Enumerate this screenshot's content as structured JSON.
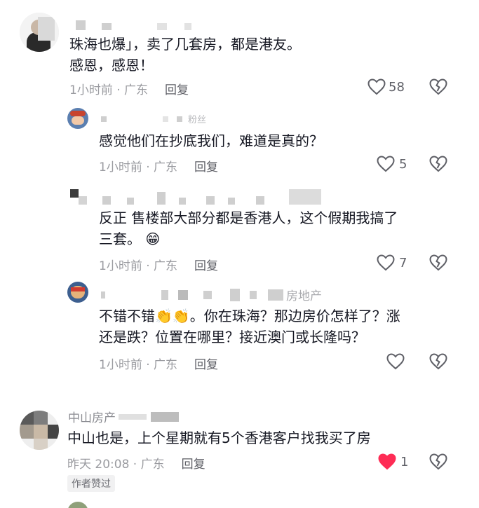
{
  "comments": [
    {
      "id": "c1",
      "username": "",
      "text_lines": [
        "珠海也爆」，卖了几套房，都是港友。",
        "感恩，感恩！"
      ],
      "meta": "1小时前 · 广东",
      "reply_label": "回复",
      "likes": "58",
      "liked": false
    },
    {
      "id": "c2",
      "username_suffix": "粉丝",
      "text_lines": [
        "感觉他们在抄底我们，难道是真的？"
      ],
      "meta": "1小时前 · 广东",
      "reply_label": "回复",
      "likes": "5",
      "liked": false
    },
    {
      "id": "c3",
      "text_lines": [
        "反正 售楼部大部分都是香港人，这个假期我搞了",
        "三套。"
      ],
      "emoji": "😁",
      "meta": "1小时前 · 广东",
      "reply_label": "回复",
      "likes": "7",
      "liked": false
    },
    {
      "id": "c4",
      "username_suffix": "房地产",
      "text_lines": [
        "不错不错👏👏。你在珠海？那边房价怎样了？涨",
        "还是跌？位置在哪里？接近澳门或长隆吗？"
      ],
      "meta": "1小时前 · 广东",
      "reply_label": "回复",
      "likes": "",
      "liked": false
    },
    {
      "id": "c5",
      "username": "中山房产",
      "text_lines": [
        "中山也是，上个星期就有5个香港客户找我买了房"
      ],
      "meta": "昨天 20:08 · 广东",
      "reply_label": "回复",
      "likes": "1",
      "liked": true,
      "badge": "作者赞过"
    }
  ],
  "icons": {
    "like": "heart-outline-icon",
    "liked": "heart-filled-icon",
    "dislike": "broken-heart-icon"
  },
  "colors": {
    "liked_red": "#fe2c55",
    "text": "#161823",
    "meta": "#9a9ba0"
  }
}
